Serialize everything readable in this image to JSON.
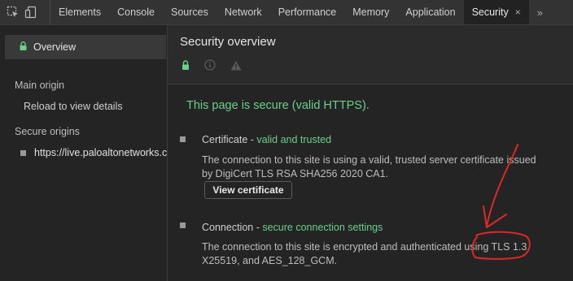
{
  "devtools": {
    "tool_icons": [
      "inspect-element-icon",
      "device-toolbar-icon"
    ],
    "tabs": [
      {
        "label": "Elements"
      },
      {
        "label": "Console"
      },
      {
        "label": "Sources"
      },
      {
        "label": "Network"
      },
      {
        "label": "Performance"
      },
      {
        "label": "Memory"
      },
      {
        "label": "Application"
      },
      {
        "label": "Security",
        "active": true
      }
    ],
    "close_glyph": "×",
    "more_glyph": "»"
  },
  "sidebar": {
    "overview_label": "Overview",
    "main_origin_heading": "Main origin",
    "reload_label": "Reload to view details",
    "secure_origins_heading": "Secure origins",
    "origin_url": "https://live.paloaltonetworks.com"
  },
  "main": {
    "title": "Security overview",
    "status_icons": [
      "lock-icon",
      "info-icon",
      "warning-icon"
    ],
    "secure_message": "This page is secure (valid HTTPS).",
    "certificate": {
      "label": "Certificate - ",
      "status": "valid and trusted",
      "description": "The connection to this site is using a valid, trusted server certificate issued by DigiCert TLS RSA SHA256 2020 CA1.",
      "button_label": "View certificate"
    },
    "connection": {
      "label": "Connection - ",
      "status": "secure connection settings",
      "description": "The connection to this site is encrypted and authenticated using TLS 1.3, X25519, and AES_128_GCM."
    }
  },
  "colors": {
    "secure_green": "#6bd089",
    "annotation_red": "#e0272a"
  }
}
